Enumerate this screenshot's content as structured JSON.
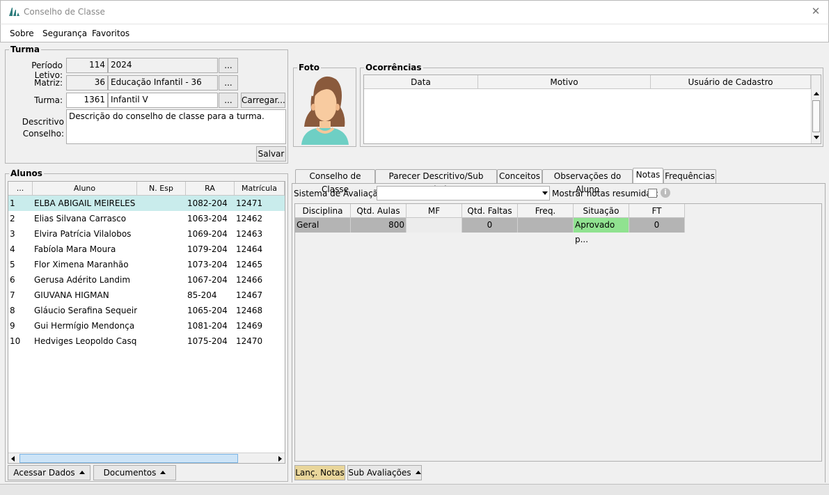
{
  "window": {
    "title": "Conselho de Classe",
    "close": "✕"
  },
  "menu": [
    "Sobre",
    "Segurança",
    "Favoritos"
  ],
  "turma": {
    "group_title": "Turma",
    "periodo_label": "Período Letivo:",
    "periodo_code": "114",
    "periodo_value": "2024",
    "matriz_label": "Matriz:",
    "matriz_code": "36",
    "matriz_value": "Educação Infantil - 36",
    "turma_label": "Turma:",
    "turma_code": "1361",
    "turma_value": "Infantil V",
    "lookup": "...",
    "carregar": "Carregar...",
    "descritivo_label_1": "Descritivo",
    "descritivo_label_2": "Conselho:",
    "descritivo_value": "Descrição do conselho de classe para a turma.",
    "salvar": "Salvar"
  },
  "foto": {
    "group_title": "Foto"
  },
  "ocorrencias": {
    "group_title": "Ocorrências",
    "columns": [
      "Data",
      "Motivo",
      "Usuário de Cadastro"
    ]
  },
  "alunos": {
    "group_title": "Alunos",
    "columns": [
      "...",
      "Aluno",
      "N. Esp",
      "RA",
      "Matrícula"
    ],
    "rows": [
      {
        "n": "1",
        "nome": "ELBA ABIGAIL MEIRELES",
        "esp": "",
        "ra": "1082-204",
        "mat": "12471"
      },
      {
        "n": "2",
        "nome": "Elias Silvana Carrasco",
        "esp": "",
        "ra": "1063-204",
        "mat": "12462"
      },
      {
        "n": "3",
        "nome": "Elvira Patrícia Vilalobos",
        "esp": "",
        "ra": "1069-204",
        "mat": "12463"
      },
      {
        "n": "4",
        "nome": "Fabíola Mara Moura",
        "esp": "",
        "ra": "1079-204",
        "mat": "12464"
      },
      {
        "n": "5",
        "nome": "Flor Ximena Maranhão",
        "esp": "",
        "ra": "1073-204",
        "mat": "12465"
      },
      {
        "n": "6",
        "nome": "Gerusa Adérito Landim",
        "esp": "",
        "ra": "1067-204",
        "mat": "12466"
      },
      {
        "n": "7",
        "nome": "GIUVANA HIGMAN",
        "esp": "",
        "ra": "85-204",
        "mat": "12467"
      },
      {
        "n": "8",
        "nome": "Gláucio Serafina Sequeira",
        "esp": "",
        "ra": "1065-204",
        "mat": "12468"
      },
      {
        "n": "9",
        "nome": "Gui Hermígio Mendonça",
        "esp": "",
        "ra": "1081-204",
        "mat": "12469"
      },
      {
        "n": "10",
        "nome": "Hedviges Leopoldo Casqu...",
        "esp": "",
        "ra": "1075-204",
        "mat": "12470"
      }
    ],
    "acessar_dados": "Acessar Dados",
    "documentos": "Documentos"
  },
  "tabs": [
    "Conselho de Classe",
    "Parecer Descritivo/Sub Periodo",
    "Conceitos",
    "Observações do Aluno",
    "Notas",
    "Frequências"
  ],
  "notas": {
    "sistema_label": "Sistema de Avaliação:",
    "sistema_value": "",
    "mostrar_label": "Mostrar notas resumidas:",
    "columns": [
      "Disciplina",
      "Qtd. Aulas",
      "MF",
      "Qtd. Faltas",
      "Freq.",
      "Situação",
      "FT"
    ],
    "rows": [
      {
        "disciplina": "Geral",
        "aulas": "800",
        "mf": "",
        "faltas": "0",
        "freq": "",
        "situacao": "Aprovado p...",
        "ft": "0"
      }
    ],
    "lanc_notas": "Lanç. Notas",
    "sub_avaliacoes": "Sub Avaliações"
  },
  "colors": {
    "selected_row": "#c9ecec",
    "approved": "#90e290",
    "grey_cell": "#b4b4b4",
    "lanc_button": "#e9d69b"
  }
}
